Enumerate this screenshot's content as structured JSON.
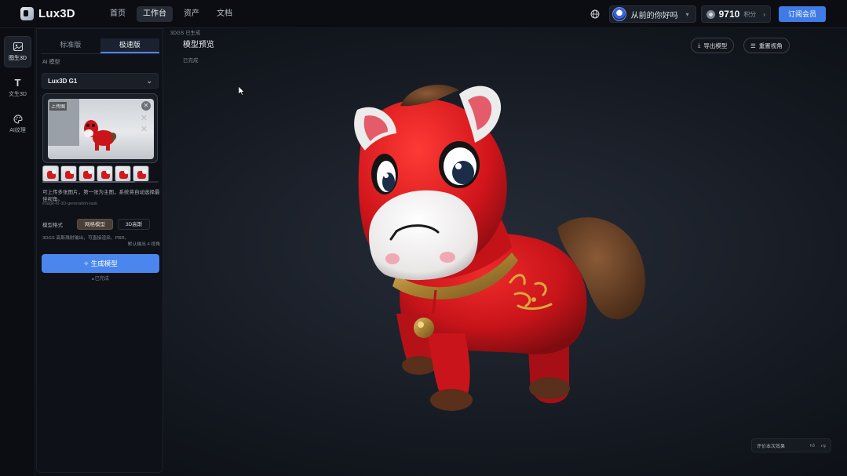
{
  "app": {
    "name": "Lux3D"
  },
  "nav": [
    {
      "label": "首页",
      "active": false
    },
    {
      "label": "工作台",
      "active": true
    },
    {
      "label": "资产",
      "active": false
    },
    {
      "label": "文档",
      "active": false
    }
  ],
  "user": {
    "name": "从前的你好吗"
  },
  "credits": {
    "value": "9710",
    "unit": "积分"
  },
  "subscribe_label": "订阅会员",
  "rail": [
    {
      "label": "图生3D",
      "icon": "image-icon",
      "active": true
    },
    {
      "label": "文生3D",
      "icon": "text-icon",
      "active": false
    },
    {
      "label": "AI纹理",
      "icon": "palette-icon",
      "active": false
    }
  ],
  "panel": {
    "tabs": [
      {
        "label": "标准版",
        "active": false
      },
      {
        "label": "极速版",
        "active": true
      }
    ],
    "model_label": "AI 模型",
    "model_value": "Lux3D G1",
    "preview_tag": "上传图",
    "hint": "可上传多张图片，第一张为主图，系统将自动选择最佳视角。",
    "hint_small": "image-to-3D-generation-task",
    "format_label": "模型格式",
    "format_on": "网格模型",
    "format_off": "3D高斯",
    "format_desc": "3DGS 高斯溅射输出，可直接渲染、PBR，",
    "format_desc2": "默认输出 4 视角",
    "generate_label": "生成模型",
    "generate_note": "已完成"
  },
  "main": {
    "badge": "3DGS 已生成",
    "title": "模型预览",
    "subtitle": "已完成",
    "export_label": "导出模型",
    "reset_label": "重置视角",
    "feedback_label": "评价本次效果"
  },
  "colors": {
    "accent": "#4a86ee",
    "toy_red": "#d7191d",
    "toy_brown": "#6b4329",
    "gold": "#b8923f"
  }
}
